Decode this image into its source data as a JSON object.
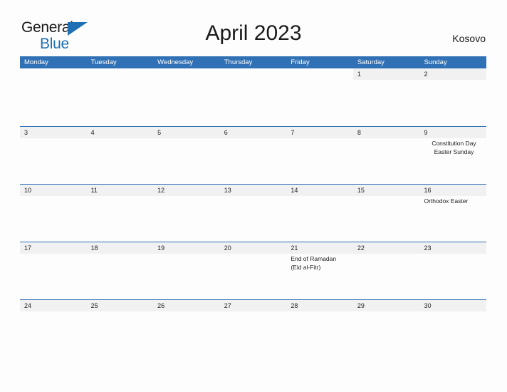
{
  "logo": {
    "word1": "General",
    "word2": "Blue",
    "triangle_icon": "triangle-flag-icon",
    "color_dark": "#1a1a1a",
    "color_blue": "#1f6fb5"
  },
  "header": {
    "title": "April 2023",
    "country": "Kosovo"
  },
  "theme": {
    "header_blue": "#3071b5",
    "band_gray": "#f1f1f1",
    "page_bg": "#fdfdfd",
    "text": "#222222"
  },
  "calendar": {
    "day_names": [
      "Monday",
      "Tuesday",
      "Wednesday",
      "Thursday",
      "Friday",
      "Saturday",
      "Sunday"
    ],
    "weeks": [
      {
        "days": [
          {
            "date": "",
            "events": []
          },
          {
            "date": "",
            "events": []
          },
          {
            "date": "",
            "events": []
          },
          {
            "date": "",
            "events": []
          },
          {
            "date": "",
            "events": []
          },
          {
            "date": "1",
            "events": []
          },
          {
            "date": "2",
            "events": []
          }
        ]
      },
      {
        "days": [
          {
            "date": "3",
            "events": []
          },
          {
            "date": "4",
            "events": []
          },
          {
            "date": "5",
            "events": []
          },
          {
            "date": "6",
            "events": []
          },
          {
            "date": "7",
            "events": []
          },
          {
            "date": "8",
            "events": []
          },
          {
            "date": "9",
            "events": [
              "Constitution Day",
              "Easter Sunday"
            ],
            "align": "center"
          }
        ]
      },
      {
        "days": [
          {
            "date": "10",
            "events": []
          },
          {
            "date": "11",
            "events": []
          },
          {
            "date": "12",
            "events": []
          },
          {
            "date": "13",
            "events": []
          },
          {
            "date": "14",
            "events": []
          },
          {
            "date": "15",
            "events": []
          },
          {
            "date": "16",
            "events": [
              "Orthodox Easter"
            ]
          }
        ]
      },
      {
        "days": [
          {
            "date": "17",
            "events": []
          },
          {
            "date": "18",
            "events": []
          },
          {
            "date": "19",
            "events": []
          },
          {
            "date": "20",
            "events": []
          },
          {
            "date": "21",
            "events": [
              "End of Ramadan",
              "(Eid al-Fitr)"
            ]
          },
          {
            "date": "22",
            "events": []
          },
          {
            "date": "23",
            "events": []
          }
        ]
      },
      {
        "days": [
          {
            "date": "24",
            "events": []
          },
          {
            "date": "25",
            "events": []
          },
          {
            "date": "26",
            "events": []
          },
          {
            "date": "27",
            "events": []
          },
          {
            "date": "28",
            "events": []
          },
          {
            "date": "29",
            "events": []
          },
          {
            "date": "30",
            "events": []
          }
        ]
      }
    ]
  }
}
